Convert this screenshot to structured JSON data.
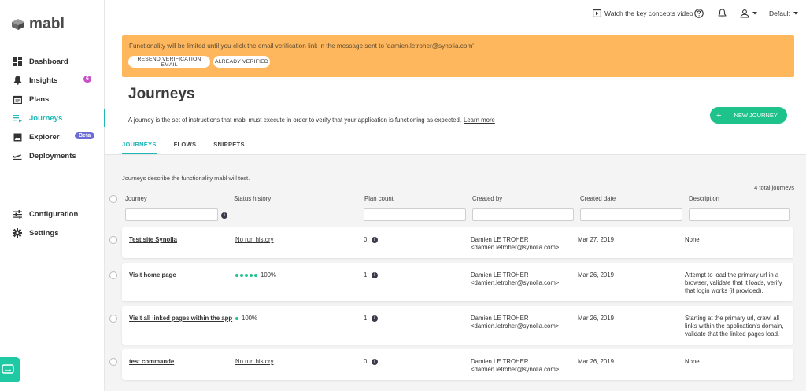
{
  "app": {
    "name": "mabl"
  },
  "sidebar": {
    "items": [
      {
        "label": "Dashboard",
        "icon": "dashboard-icon"
      },
      {
        "label": "Insights",
        "icon": "bell-icon",
        "badge": "6"
      },
      {
        "label": "Plans",
        "icon": "calendar-icon"
      },
      {
        "label": "Journeys",
        "icon": "journeys-icon",
        "active": true
      },
      {
        "label": "Explorer",
        "icon": "image-icon",
        "badge": "Beta"
      },
      {
        "label": "Deployments",
        "icon": "plane-icon"
      }
    ],
    "bottom_items": [
      {
        "label": "Configuration",
        "icon": "sliders-icon"
      },
      {
        "label": "Settings",
        "icon": "gear-icon"
      }
    ]
  },
  "topbar": {
    "watch_label": "Watch the key concepts video",
    "workspace": "Default"
  },
  "banner": {
    "text": "Functionality will be limited until you click the email verification link in the message sent to 'damien.letroher@synolia.com'",
    "resend_label": "RESEND VERIFICATION EMAIL",
    "verified_label": "ALREADY VERIFIED"
  },
  "page": {
    "title": "Journeys",
    "description": "A journey is the set of instructions that mabl must execute in order to verify that your application is functioning as expected.",
    "learn_more": "Learn more",
    "new_button": "NEW JOURNEY",
    "new_button_icon": "+"
  },
  "tabs": [
    "JOURNEYS",
    "FLOWS",
    "SNIPPETS"
  ],
  "list": {
    "subtitle": "Journeys describe the functionality mabl will test.",
    "total": "4 total journeys",
    "columns": [
      "Journey",
      "Status history",
      "Plan count",
      "Created by",
      "Created date",
      "Description"
    ],
    "rows": [
      {
        "name": "Test site Synolia",
        "history": "No run history",
        "dots": 0,
        "plan_count": "0",
        "created_by_name": "Damien LE TROHER",
        "created_by_email": "<damien.letroher@synolia.com>",
        "date": "Mar 27, 2019",
        "description": [
          "None"
        ]
      },
      {
        "name": "Visit home page",
        "history": "100%",
        "dots": 5,
        "plan_count": "1",
        "created_by_name": "Damien LE TROHER",
        "created_by_email": "<damien.letroher@synolia.com>",
        "date": "Mar 26, 2019",
        "description": [
          "Attempt to load the primary url in a",
          "browser, validate that it loads, verify",
          "that login works (if provided)."
        ]
      },
      {
        "name": "Visit all linked pages within the app",
        "history": "100%",
        "dots": 1,
        "plan_count": "1",
        "created_by_name": "Damien LE TROHER",
        "created_by_email": "<damien.letroher@synolia.com>",
        "date": "Mar 26, 2019",
        "description": [
          "Starting at the primary url, crawl all",
          "links within the application's domain,",
          "validate that the linked pages load."
        ]
      },
      {
        "name": "test commande",
        "history": "No run history",
        "dots": 0,
        "plan_count": "0",
        "created_by_name": "Damien LE TROHER",
        "created_by_email": "<damien.letroher@synolia.com>",
        "date": "Mar 26, 2019",
        "description": [
          "None"
        ]
      }
    ]
  },
  "colors": {
    "accent": "#1fb7b7",
    "banner": "#ffb75e",
    "success": "#1ec28b"
  }
}
